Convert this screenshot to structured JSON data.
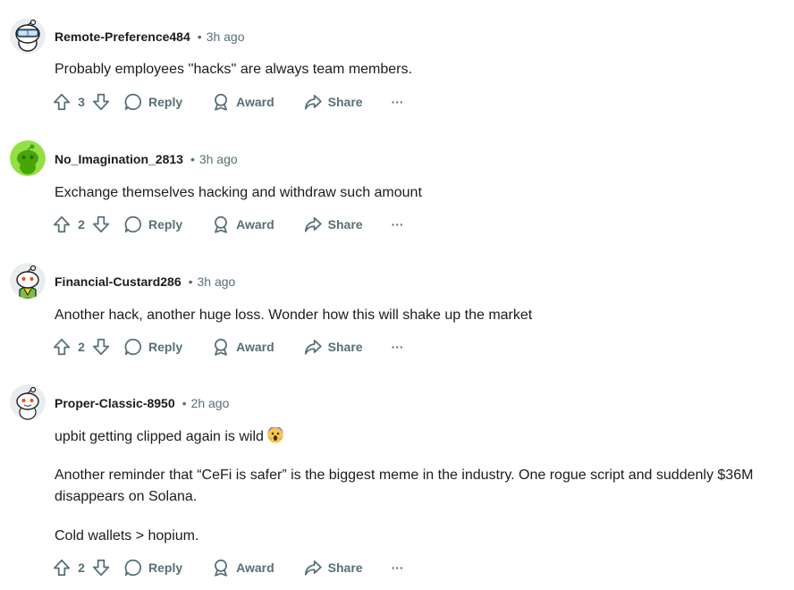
{
  "colors": {
    "text": "#1c1c1c",
    "meta": "#576f76",
    "background": "#ffffff"
  },
  "actions": {
    "reply": "Reply",
    "award": "Award",
    "share": "Share",
    "more": "···"
  },
  "comments": [
    {
      "username": "Remote-Preference484",
      "time": "3h ago",
      "avatar": "snoo-avatar-goggles",
      "votes": "3",
      "paragraphs": [
        "Probably employees ''hacks'' are always team members."
      ]
    },
    {
      "username": "No_Imagination_2813",
      "time": "3h ago",
      "avatar": "snoo-avatar-green",
      "votes": "2",
      "paragraphs": [
        "Exchange themselves hacking and withdraw such amount"
      ]
    },
    {
      "username": "Financial-Custard286",
      "time": "3h ago",
      "avatar": "snoo-avatar-green-shirt",
      "votes": "2",
      "paragraphs": [
        "Another hack, another huge loss. Wonder how this will shake up the market"
      ]
    },
    {
      "username": "Proper-Classic-8950",
      "time": "2h ago",
      "avatar": "snoo-avatar-default",
      "votes": "2",
      "paragraphs": [
        "upbit getting clipped again is wild",
        "Another reminder that “CeFi is safer” is the biggest meme in the industry. One rogue script and suddenly $36M",
        "disappears on Solana.",
        "Cold wallets > hopium."
      ],
      "emoji": "screaming-face-icon"
    }
  ]
}
